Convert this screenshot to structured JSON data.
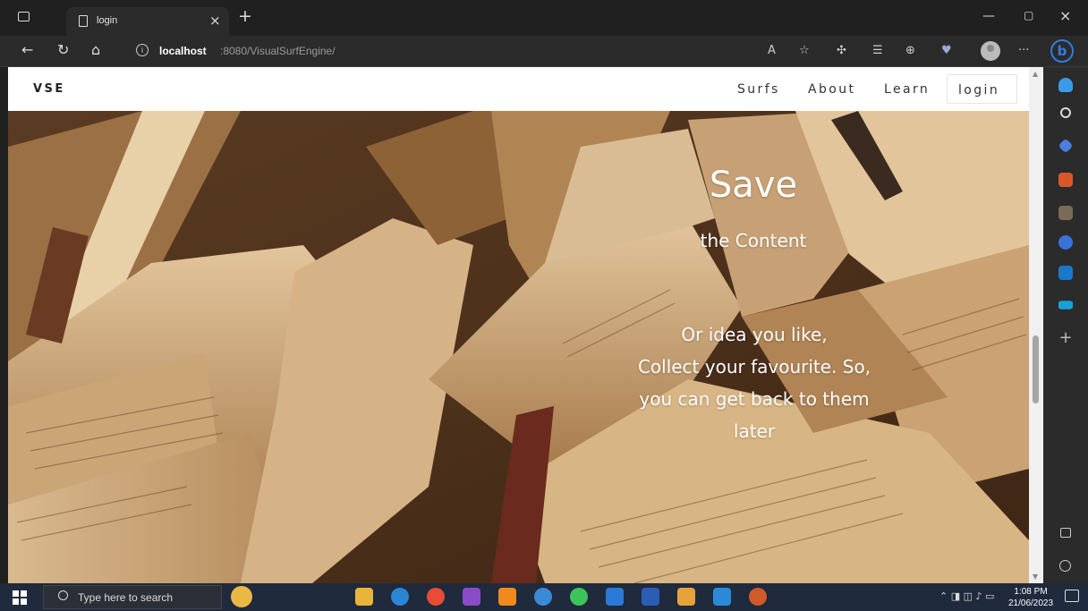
{
  "browser": {
    "tab_title": "login",
    "url_host": "localhost",
    "url_path": ":8080/VisualSurfEngine/"
  },
  "site": {
    "brand": "VSE",
    "nav": [
      {
        "label": "Surfs"
      },
      {
        "label": "About"
      },
      {
        "label": "Learn"
      },
      {
        "label": "login"
      }
    ]
  },
  "hero": {
    "title": "Save",
    "subtitle": "the Content",
    "body_lines": [
      "Or idea you like,",
      "Collect your favourite. So,",
      "you can get back to them",
      "later"
    ]
  },
  "taskbar": {
    "search_placeholder": "Type here to search",
    "time": "1:08 PM",
    "date": "21/06/2023"
  },
  "icons": {
    "back": "back-arrow-icon",
    "refresh": "refresh-icon",
    "home": "home-icon",
    "info": "info-icon",
    "favorite": "star-icon",
    "extensions": "extensions-icon",
    "collections": "collections-icon",
    "profile": "profile-icon",
    "bing": "bing-icon"
  },
  "colors": {
    "browser_bg": "#202020",
    "toolbar_bg": "#2b2b2b",
    "navbar_bg": "#ffffff",
    "bing_blue": "#2f7de0",
    "taskbar_bg": "#1f2a3c"
  }
}
